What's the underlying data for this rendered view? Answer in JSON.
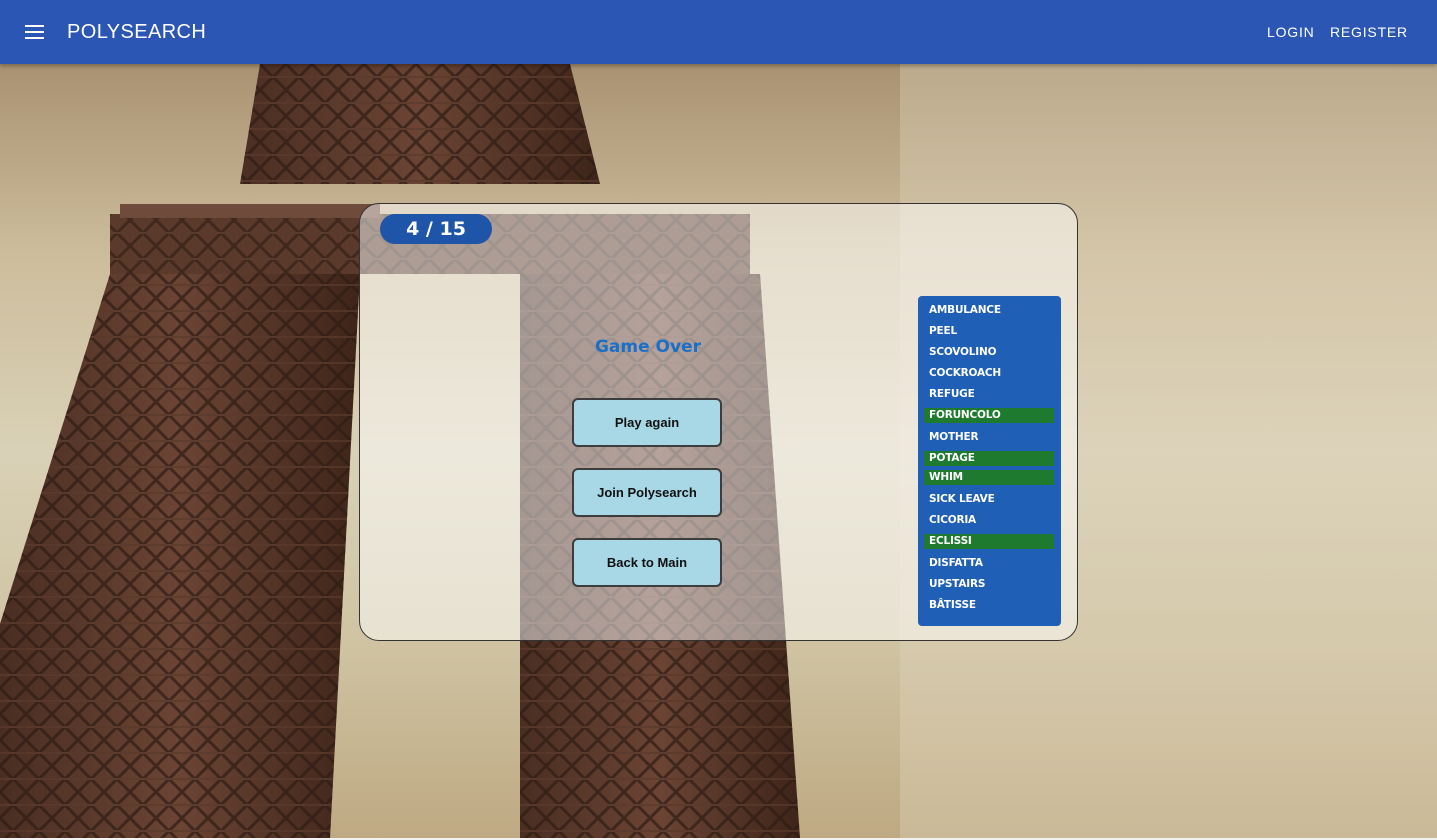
{
  "appbar": {
    "brand": "POLYSEARCH",
    "menu_icon": "menu-icon",
    "login_label": "LOGIN",
    "register_label": "REGISTER",
    "background_color": "#2b56b4"
  },
  "game": {
    "score_text": "4 / 15",
    "found_count": 4,
    "total_count": 15,
    "status_title": "Game Over",
    "buttons": {
      "play_again": "Play again",
      "join": "Join Polysearch",
      "back": "Back to Main"
    },
    "words": [
      {
        "text": "AMBULANCE",
        "found": false
      },
      {
        "text": "PEEL",
        "found": false
      },
      {
        "text": "SCOVOLINO",
        "found": false
      },
      {
        "text": "COCKROACH",
        "found": false
      },
      {
        "text": "REFUGE",
        "found": false
      },
      {
        "text": "FORUNCOLO",
        "found": true
      },
      {
        "text": "MOTHER",
        "found": false
      },
      {
        "text": "POTAGE",
        "found": true
      },
      {
        "text": "WHIM",
        "found": true
      },
      {
        "text": "SICK LEAVE",
        "found": false
      },
      {
        "text": "CICORIA",
        "found": false
      },
      {
        "text": "ECLISSI",
        "found": true
      },
      {
        "text": "DISFATTA",
        "found": false
      },
      {
        "text": "UPSTAIRS",
        "found": false
      },
      {
        "text": "BÂTISSE",
        "found": false
      }
    ],
    "colors": {
      "word_list_bg": "#1f5fb5",
      "found_word_bg": "#1d7a2e",
      "button_bg": "#a8d8e6",
      "title_color": "#1a6fc8"
    }
  },
  "background": {
    "image": "eiffel-tower-photo"
  }
}
